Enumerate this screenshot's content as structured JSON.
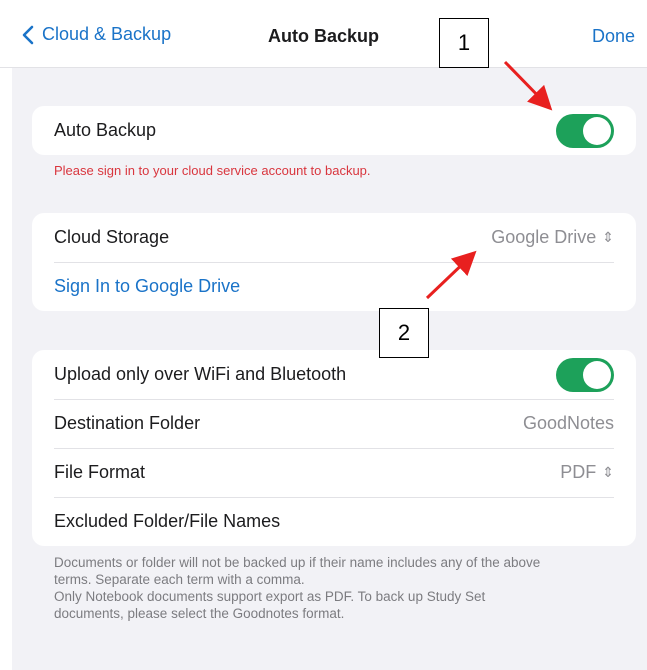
{
  "nav": {
    "back_label": "Cloud & Backup",
    "title": "Auto Backup",
    "done_label": "Done"
  },
  "auto_backup": {
    "label": "Auto Backup",
    "enabled": true,
    "error": "Please sign in to your cloud service account to backup."
  },
  "cloud": {
    "storage_label": "Cloud Storage",
    "storage_value": "Google Drive",
    "sign_in_label": "Sign In to Google Drive"
  },
  "options": {
    "upload_label": "Upload only over WiFi and Bluetooth",
    "upload_enabled": true,
    "destination_label": "Destination Folder",
    "destination_value": "GoodNotes",
    "format_label": "File Format",
    "format_value": "PDF",
    "excluded_label": "Excluded Folder/File Names"
  },
  "footnote": {
    "line1": "Documents or folder will not be backed up if their name includes any of the above",
    "line2": "terms. Separate each term with a comma.",
    "line3": "Only Notebook documents support export as PDF. To back up Study Set",
    "line4": "documents, please select the Goodnotes format."
  },
  "callouts": {
    "one": "1",
    "two": "2"
  },
  "colors": {
    "accent": "#1a73c8",
    "toggle_on": "#1da15a",
    "error": "#d9363e",
    "arrow": "#e8201f"
  }
}
